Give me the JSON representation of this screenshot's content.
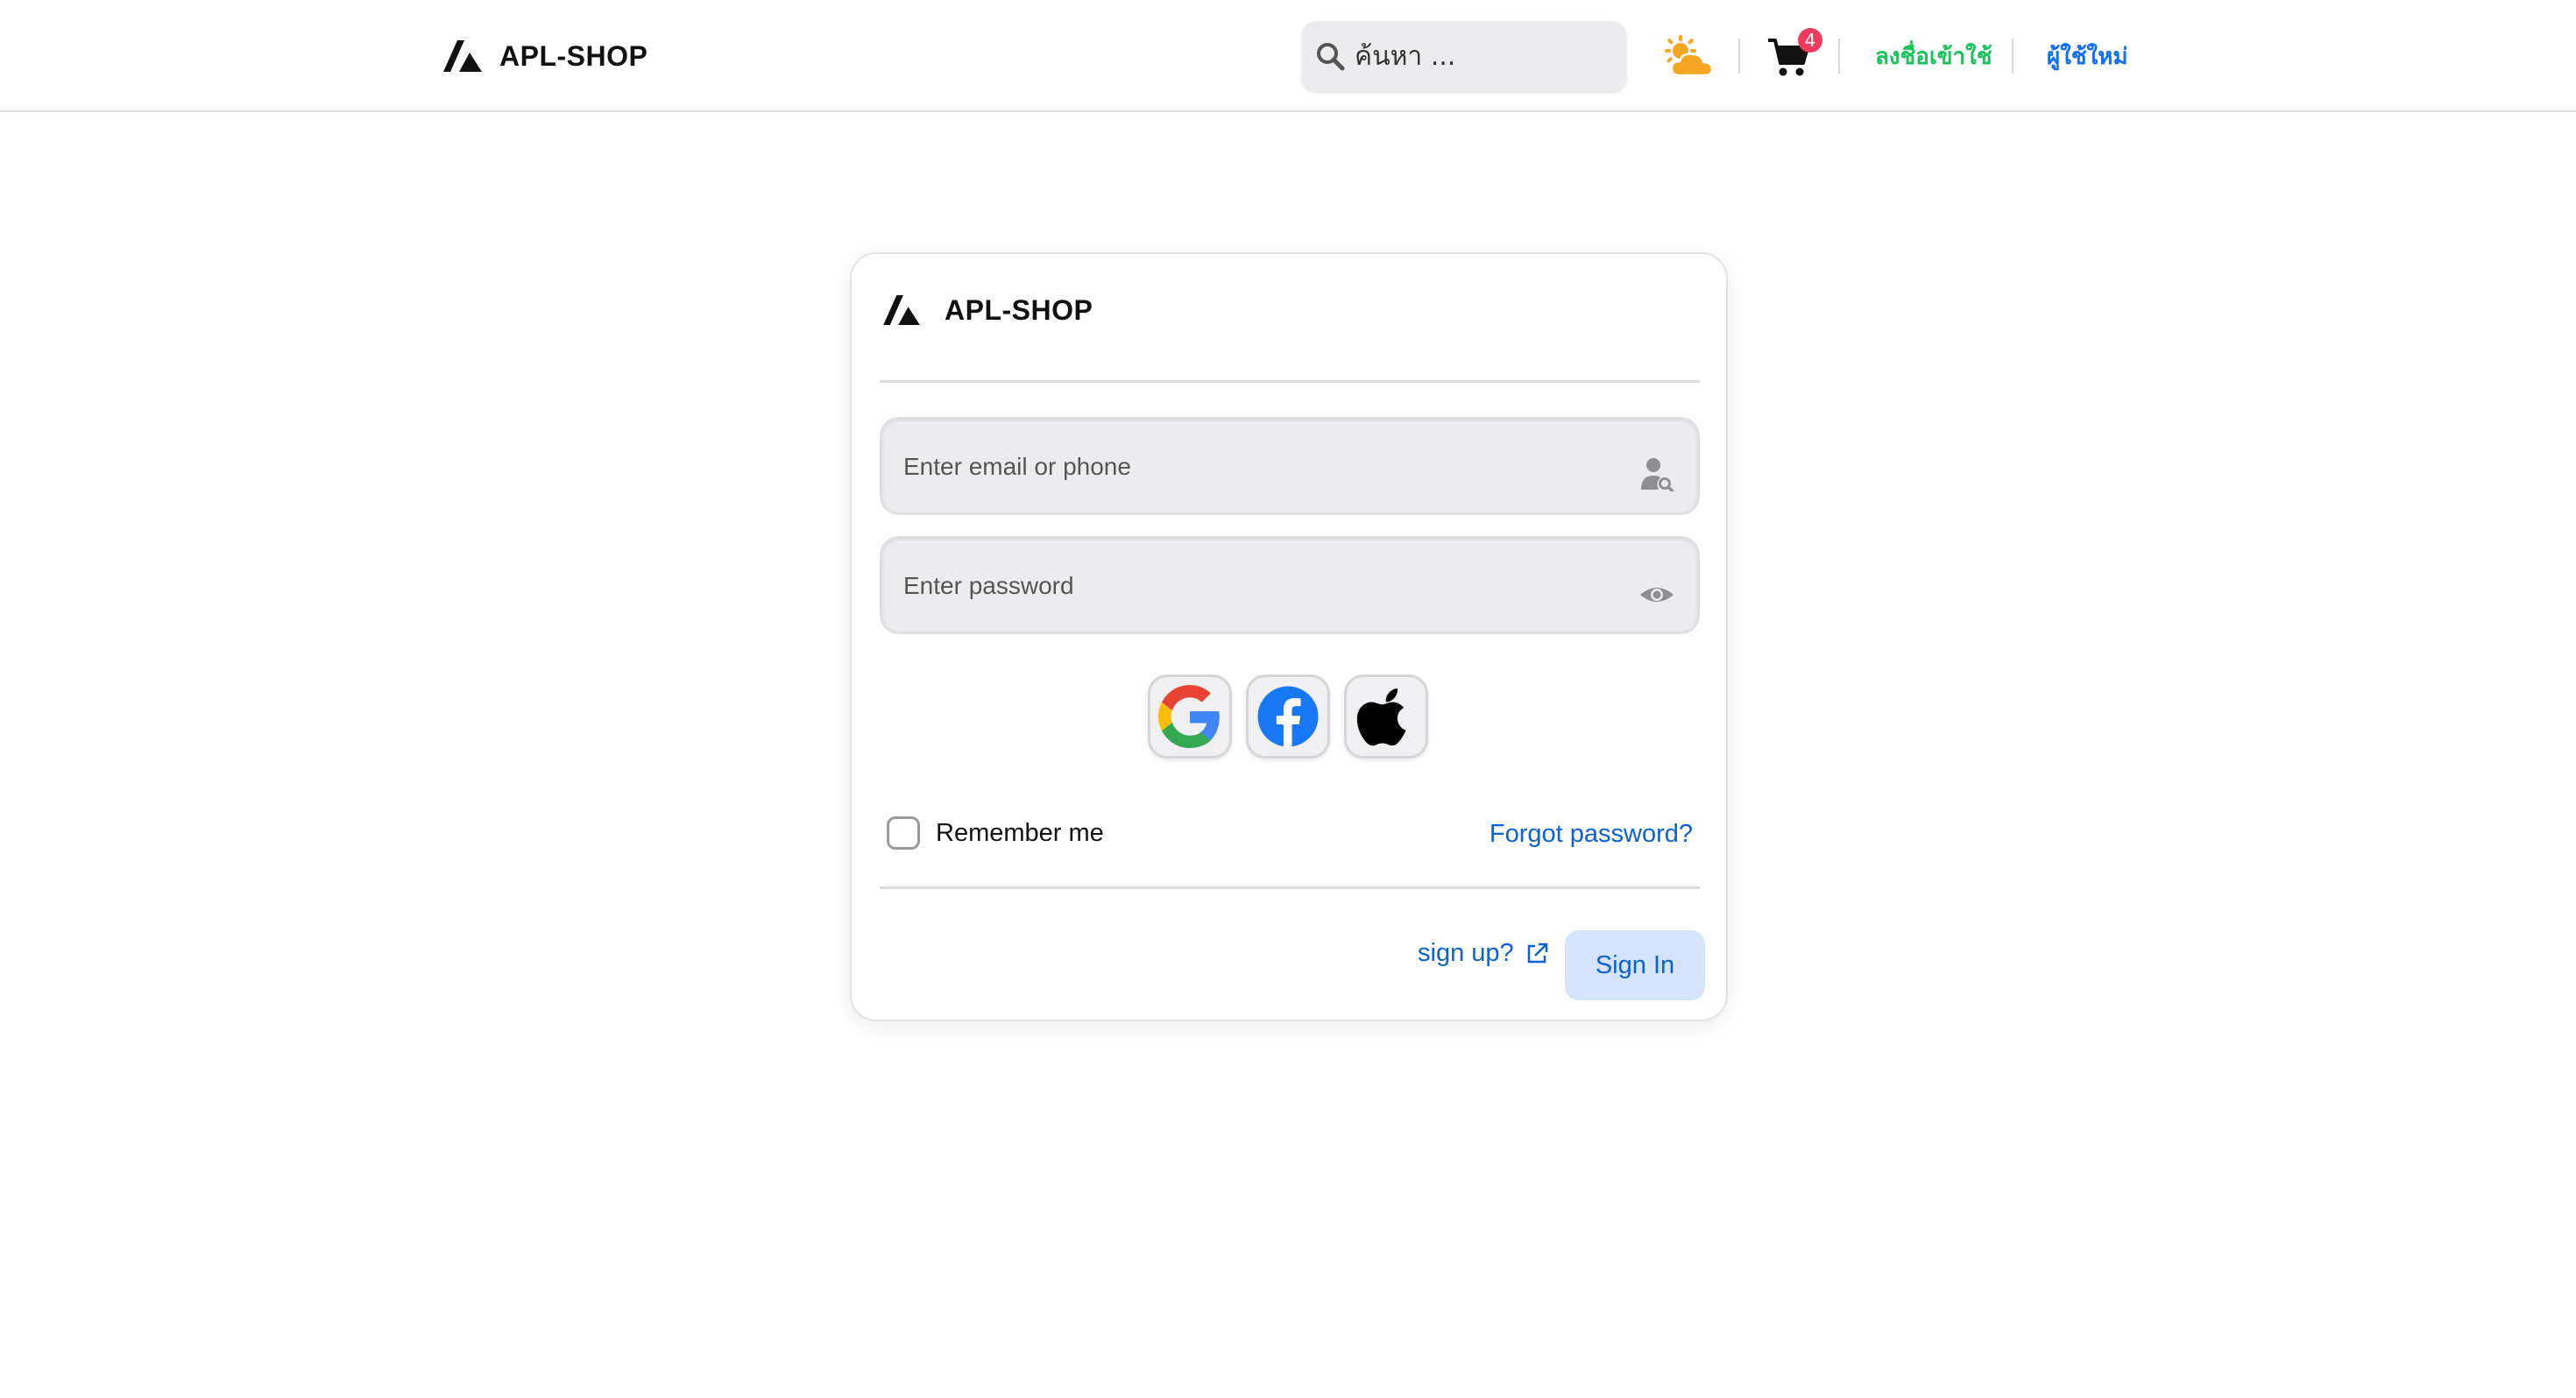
{
  "header": {
    "brand": "APL-SHOP",
    "search_placeholder": "ค้นหา ...",
    "cart_count": "4",
    "login_link": "ลงชื่อเข้าใช้",
    "new_user_link": "ผู้ใช้ใหม่"
  },
  "card": {
    "brand": "APL-SHOP",
    "email_placeholder": "Enter email or phone",
    "password_placeholder": "Enter password",
    "social_buttons": [
      "google",
      "facebook",
      "apple"
    ],
    "remember_label": "Remember me",
    "forgot_label": "Forgot password?",
    "signup_label": "sign up?",
    "signin_label": "Sign In"
  },
  "colors": {
    "login_green": "#19c35a",
    "link_blue": "#0b62d6",
    "badge_red": "#ef3b5d",
    "signin_bg": "#d4e4fc"
  }
}
